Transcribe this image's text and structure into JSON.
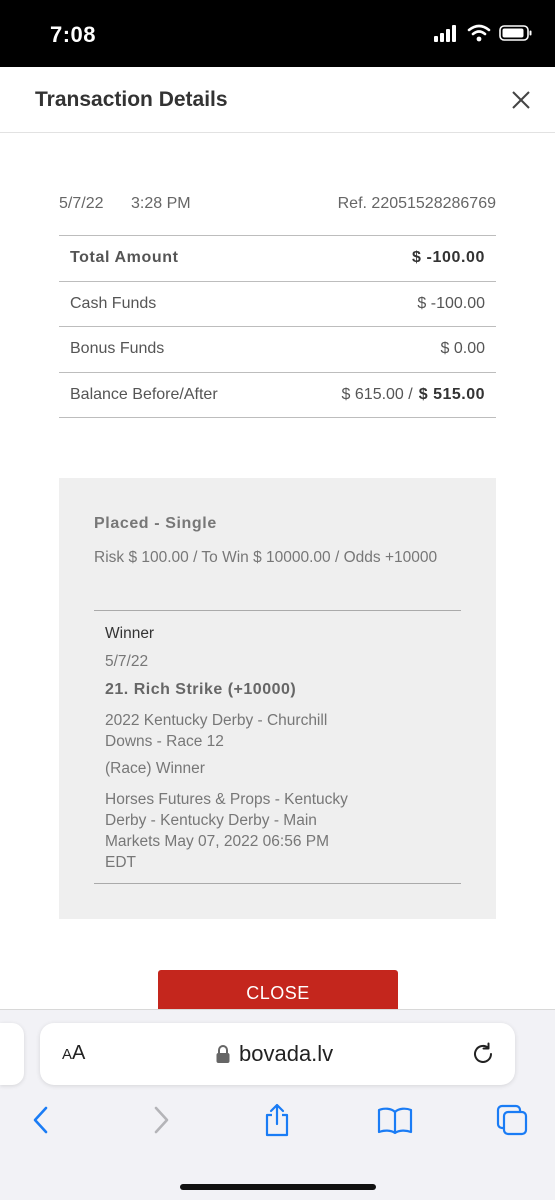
{
  "status_bar": {
    "time": "7:08"
  },
  "header": {
    "title": "Transaction Details"
  },
  "transaction": {
    "date": "5/7/22",
    "time": "3:28 PM",
    "ref": "Ref. 22051528286769",
    "rows": {
      "total": {
        "label": "Total Amount",
        "value": "$ -100.00"
      },
      "cash": {
        "label": "Cash Funds",
        "value": "$ -100.00"
      },
      "bonus": {
        "label": "Bonus Funds",
        "value": "$ 0.00"
      },
      "balance": {
        "label": "Balance Before/After",
        "before": "$ 615.00 /",
        "after": "$ 515.00"
      }
    }
  },
  "bet": {
    "title": "Placed - Single",
    "risk_line": "Risk $ 100.00 / To Win $ 10000.00 / Odds +10000",
    "status": "Winner",
    "date": "5/7/22",
    "selection": "21. Rich Strike (+10000)",
    "event": "2022 Kentucky Derby - Churchill Downs - Race 12",
    "market": "(Race) Winner",
    "category": "Horses Futures & Props - Kentucky Derby - Kentucky Derby - Main Markets May 07, 2022 06:56 PM EDT"
  },
  "close_button": {
    "label": "CLOSE"
  },
  "browser": {
    "aa_large": "A",
    "aa_small": "A",
    "url": "bovada.lv"
  },
  "colors": {
    "accent": "#c4261d",
    "ios_blue": "#1a7cf5"
  },
  "icons": [
    "signal-icon",
    "wifi-icon",
    "battery-icon",
    "close-icon",
    "lock-icon",
    "reload-icon",
    "back-icon",
    "forward-icon",
    "share-icon",
    "bookmarks-icon",
    "tabs-icon"
  ]
}
